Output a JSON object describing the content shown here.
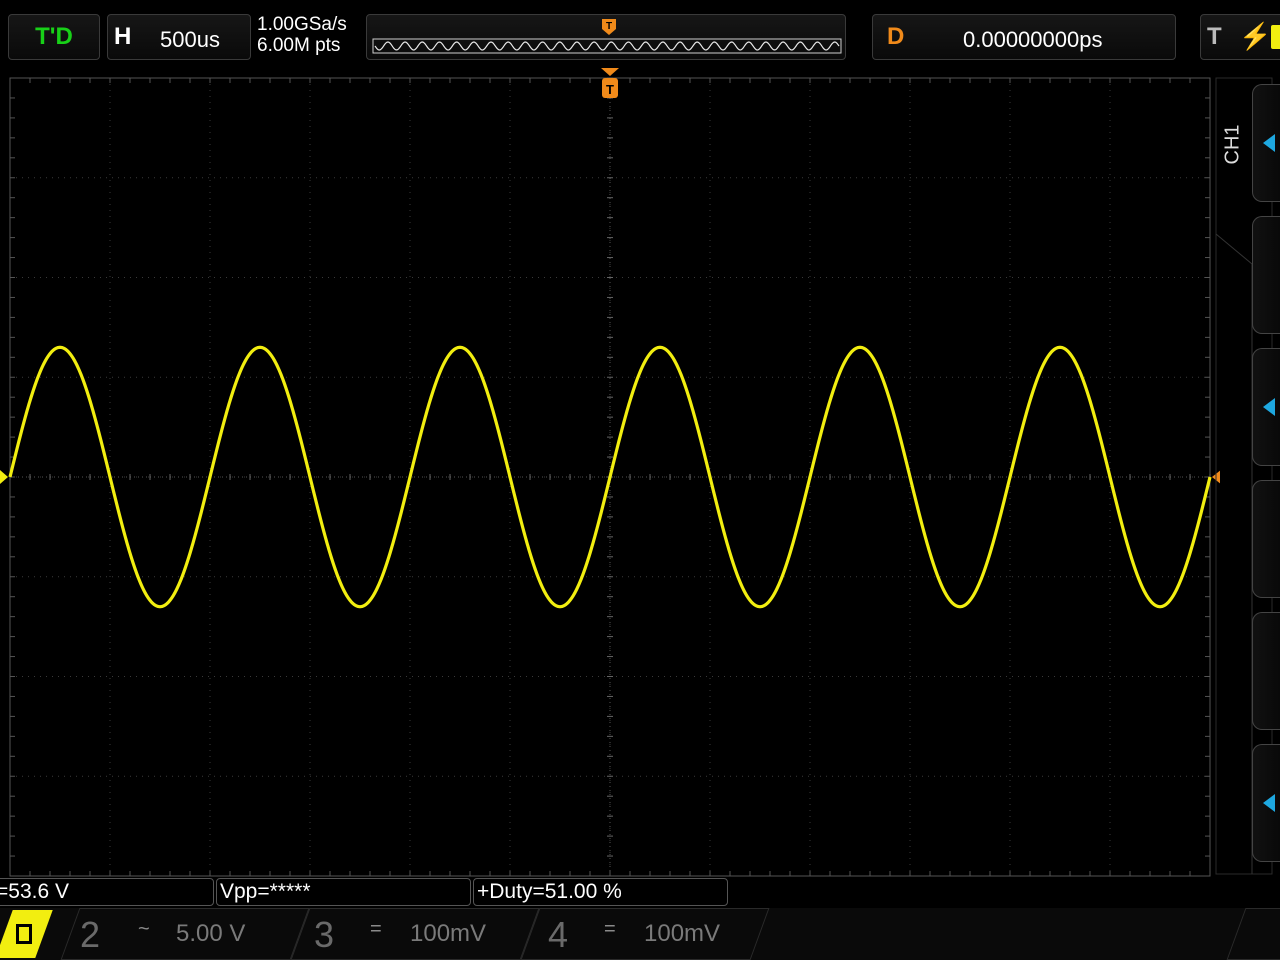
{
  "colors": {
    "ch1": "#f2ee10",
    "run": "#18d018",
    "trigger": "#f08a1a",
    "accent": "#1ea8e0"
  },
  "header": {
    "run_status": "T'D",
    "horizontal_label": "H",
    "timebase": "500us",
    "sample_rate": "1.00GSa/s",
    "memory_depth": "6.00M pts",
    "delay_label": "D",
    "delay_value": "0.00000000ps",
    "trigger_label": "T",
    "trigger_edge_icon": "rising-edge-icon",
    "memory_trigger_marker": "T"
  },
  "screen": {
    "trigger_position_marker": "T",
    "trigger_level_marker": "T",
    "waveform": {
      "channel": "CH1",
      "shape": "sine",
      "cycles_visible": 6,
      "amplitude_divisions": 1.3
    }
  },
  "side_panel": {
    "channel_label": "CH1",
    "softkeys": [
      {
        "name": "softkey-1",
        "has_arrow": true
      },
      {
        "name": "softkey-2",
        "has_arrow": false
      },
      {
        "name": "softkey-3",
        "has_arrow": true
      },
      {
        "name": "softkey-4",
        "has_arrow": false
      },
      {
        "name": "softkey-5",
        "has_arrow": false
      },
      {
        "name": "softkey-6",
        "has_arrow": true
      }
    ]
  },
  "measurements": [
    {
      "text": "=53.6 V"
    },
    {
      "text": "Vpp=*****"
    },
    {
      "text": "+Duty=51.00 %"
    }
  ],
  "channels": [
    {
      "number": "2",
      "coupling": "~",
      "scale": "5.00 V"
    },
    {
      "number": "3",
      "coupling": "=",
      "scale": "100mV"
    },
    {
      "number": "4",
      "coupling": "=",
      "scale": "100mV"
    }
  ]
}
